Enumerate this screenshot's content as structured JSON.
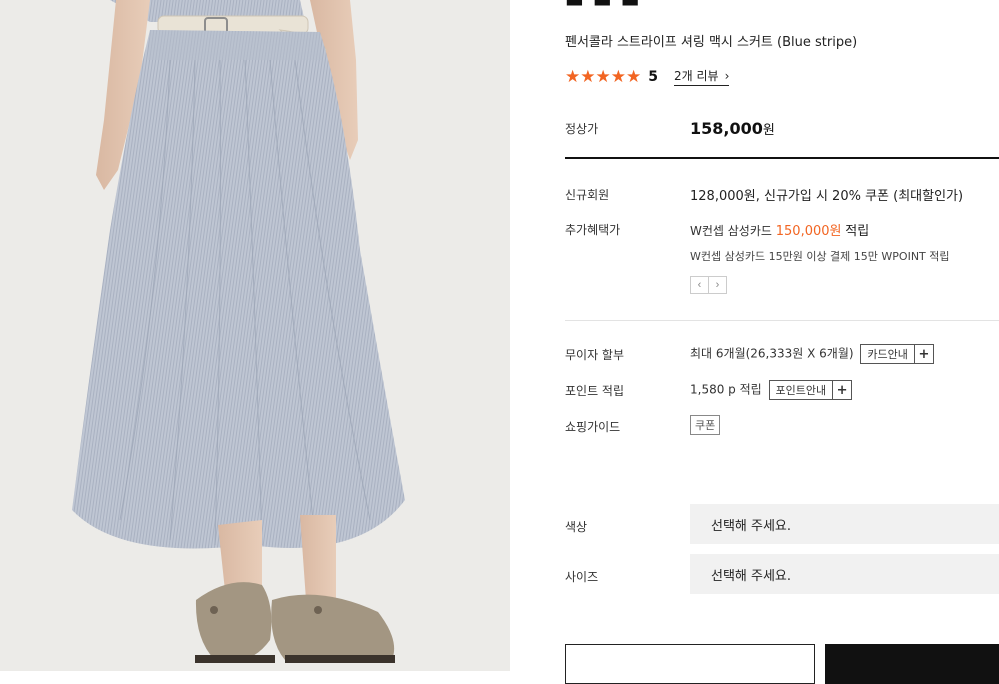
{
  "product": {
    "name": "펜서콜라 스트라이프 셔링 맥시 스커트 (Blue stripe)",
    "rating": {
      "score": "5",
      "stars": 5,
      "review_link": "2개 리뷰",
      "star_glyph": "★",
      "chevron": "›"
    },
    "price": {
      "label": "정상가",
      "amount": "158,000",
      "unit": "원"
    }
  },
  "benefits": {
    "new_member": {
      "label": "신규회원",
      "text": "128,000원, 신규가입 시 20% 쿠폰 (최대할인가)"
    },
    "extra": {
      "label": "추가혜택가",
      "card": "W컨셉 삼성카드",
      "amount": "150,000원",
      "suffix": "적립",
      "note": "W컨셉 삼성카드 15만원 이상 결제 15만 WPOINT 적립",
      "prev": "‹",
      "next": "›"
    }
  },
  "info_rows": {
    "installment": {
      "label": "무이자 할부",
      "text": "최대 6개월(26,333원 X 6개월)",
      "button": "카드안내",
      "plus": "+"
    },
    "points": {
      "label": "포인트 적립",
      "text": "1,580 p 적립",
      "button": "포인트안내",
      "plus": "+"
    },
    "guide": {
      "label": "쇼핑가이드",
      "tag": "쿠폰"
    }
  },
  "options": {
    "color": {
      "label": "색상",
      "placeholder": "선택해 주세요."
    },
    "size": {
      "label": "사이즈",
      "placeholder": "선택해 주세요."
    }
  },
  "colors": {
    "accent": "#f26522",
    "dark": "#111111",
    "select_bg": "#f1f1f1"
  }
}
